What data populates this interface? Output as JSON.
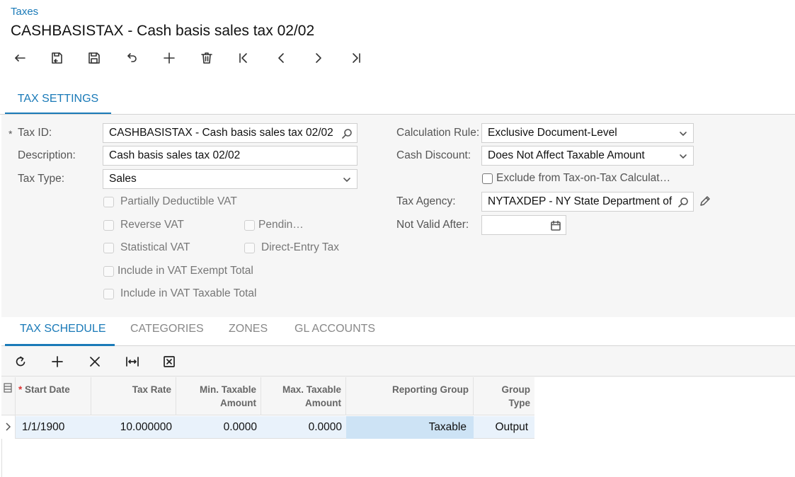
{
  "breadcrumb": "Taxes",
  "page_title": "CASHBASISTAX - Cash basis sales tax 02/02",
  "toolbar": {
    "icons": [
      "back-icon",
      "save-close-icon",
      "save-icon",
      "undo-icon",
      "add-icon",
      "delete-icon",
      "first-icon",
      "previous-icon",
      "next-icon",
      "last-icon"
    ]
  },
  "main_tab": "TAX SETTINGS",
  "form": {
    "required_mark": "*",
    "tax_id_label": "Tax ID:",
    "tax_id_value": "CASHBASISTAX - Cash basis sales tax 02/02",
    "description_label": "Description:",
    "description_value": "Cash basis sales tax 02/02",
    "tax_type_label": "Tax Type:",
    "tax_type_value": "Sales",
    "cb_partially_deductible": "Partially Deductible VAT",
    "cb_reverse_vat": "Reverse VAT",
    "cb_pending": "Pendin…",
    "cb_statistical_vat": "Statistical VAT",
    "cb_direct_entry": "Direct-Entry Tax",
    "cb_vat_exempt": "Include in VAT Exempt Total",
    "cb_vat_taxable": "Include in VAT Taxable Total",
    "calc_rule_label": "Calculation Rule:",
    "calc_rule_value": "Exclusive Document-Level",
    "cash_discount_label": "Cash Discount:",
    "cash_discount_value": "Does Not Affect Taxable Amount",
    "cb_exclude_tax_on_tax": "Exclude from Tax-on-Tax Calculat…",
    "tax_agency_label": "Tax Agency:",
    "tax_agency_value": "NYTAXDEP - NY State Department of",
    "not_valid_after_label": "Not Valid After:",
    "not_valid_after_value": ""
  },
  "sub_tabs": [
    "TAX SCHEDULE",
    "CATEGORIES",
    "ZONES",
    "GL ACCOUNTS"
  ],
  "grid": {
    "columns": [
      {
        "line1": "Start Date",
        "line2": "",
        "required": "*"
      },
      {
        "line1": "Tax Rate",
        "line2": ""
      },
      {
        "line1": "Min. Taxable",
        "line2": "Amount"
      },
      {
        "line1": "Max. Taxable",
        "line2": "Amount"
      },
      {
        "line1": "Reporting Group",
        "line2": ""
      },
      {
        "line1": "Group",
        "line2": "Type"
      }
    ],
    "rows": [
      {
        "start_date": "1/1/1900",
        "tax_rate": "10.000000",
        "min_taxable": "0.0000",
        "max_taxable": "0.0000",
        "reporting_group": "Taxable",
        "group_type": "Output"
      }
    ]
  },
  "colors": {
    "accent": "#1a7ab8",
    "selected_cell": "#cde3f5",
    "row_bg": "#e9f2fb"
  }
}
